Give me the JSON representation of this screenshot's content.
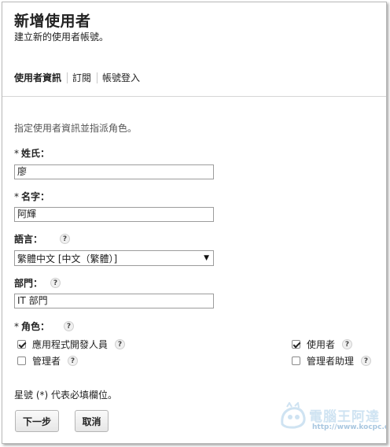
{
  "page": {
    "title": "新增使用者",
    "subtitle": "建立新的使用者帳號。"
  },
  "tabs": [
    {
      "label": "使用者資訊",
      "active": true
    },
    {
      "label": "訂閱",
      "active": false
    },
    {
      "label": "帳號登入",
      "active": false
    }
  ],
  "instruction": "指定使用者資訊並指派角色。",
  "form": {
    "last_name": {
      "required_mark": "*",
      "label": "姓氏：",
      "value": "廖"
    },
    "first_name": {
      "required_mark": "*",
      "label": "名字：",
      "value": "阿輝"
    },
    "language": {
      "label": "語言：",
      "selected": "繁體中文 [中文（繁體）]"
    },
    "department": {
      "label": "部門：",
      "value": "IT 部門"
    },
    "roles": {
      "required_mark": "*",
      "label": "角色：",
      "options": [
        {
          "label": "應用程式開發人員",
          "checked": true
        },
        {
          "label": "使用者",
          "checked": true
        },
        {
          "label": "管理者",
          "checked": false
        },
        {
          "label": "管理者助理",
          "checked": false
        }
      ]
    }
  },
  "help_icon_glyph": "?",
  "footnote": "星號 (*) 代表必填欄位。",
  "buttons": {
    "next": "下一步",
    "cancel": "取消"
  },
  "watermark": {
    "text": "電腦王阿達",
    "url": "http://www.kocpc.com.tw"
  },
  "colors": {
    "border": "#9c9c9c",
    "watermark": "#cfe3f2"
  }
}
